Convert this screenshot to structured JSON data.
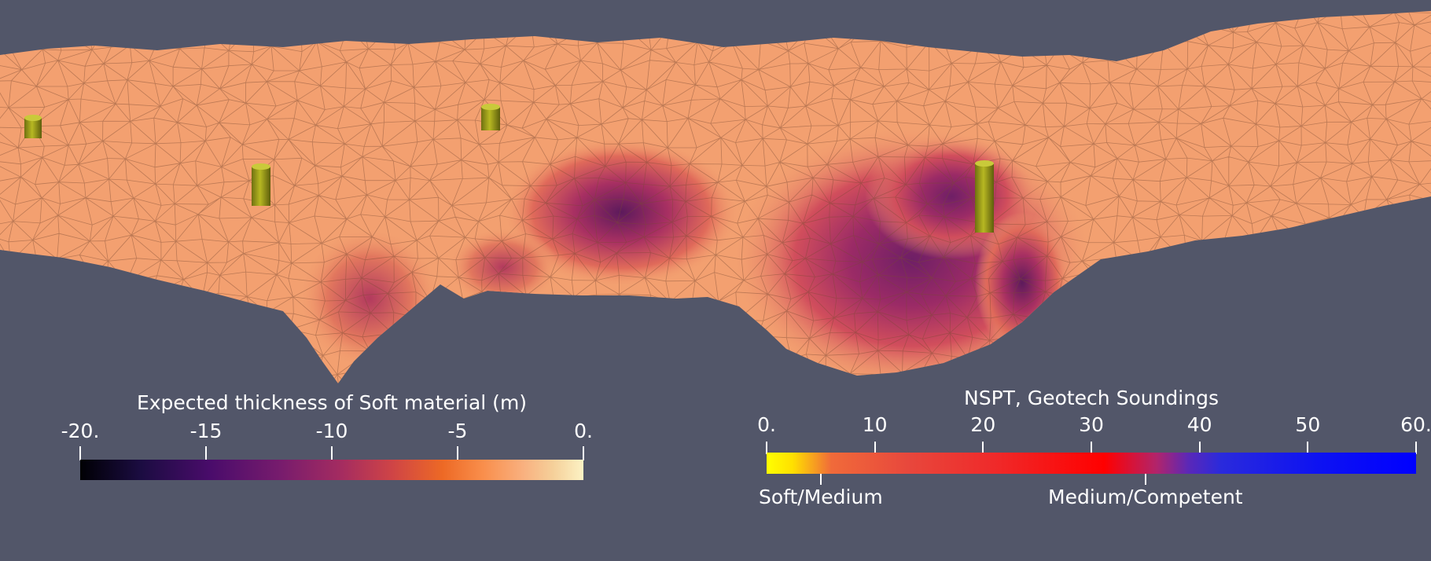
{
  "colors": {
    "background": "#525669",
    "terrain_base": "#f3a070",
    "terrain_edge": "#7a4a33",
    "pile": "#9fa016"
  },
  "colorbar_thickness": {
    "title": "Expected thickness of Soft material (m)",
    "ticks": [
      {
        "label": "-20.",
        "value": -20
      },
      {
        "label": "-15",
        "value": -15
      },
      {
        "label": "-10",
        "value": -10
      },
      {
        "label": "-5",
        "value": -5
      },
      {
        "label": "0.",
        "value": 0
      }
    ],
    "range": [
      -20,
      0
    ],
    "colormap": "magma"
  },
  "colorbar_nspt": {
    "title": "NSPT, Geotech Soundings",
    "ticks": [
      {
        "label": "0.",
        "value": 0
      },
      {
        "label": "10",
        "value": 10
      },
      {
        "label": "20",
        "value": 20
      },
      {
        "label": "30",
        "value": 30
      },
      {
        "label": "40",
        "value": 40
      },
      {
        "label": "50",
        "value": 50
      },
      {
        "label": "60.",
        "value": 60
      }
    ],
    "range": [
      0,
      60
    ],
    "annotations": [
      {
        "label": "Soft/Medium",
        "value": 5
      },
      {
        "label": "Medium/Competent",
        "value": 35
      }
    ]
  }
}
